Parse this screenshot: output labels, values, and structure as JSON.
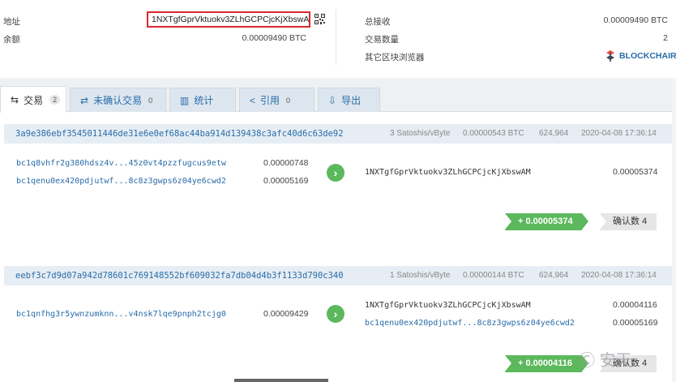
{
  "summary": {
    "address_label": "地址",
    "address": "1NXTgfGprVktuokv3ZLhGCPCjcKjXbswAM",
    "balance_label": "余额",
    "balance": "0.00009490 BTC",
    "total_received_label": "总接收",
    "total_received": "0.00009490 BTC",
    "tx_count_label": "交易数量",
    "tx_count": "2",
    "other_explorers_label": "其它区块浏览器",
    "explorer_name": "BLOCKCHAIR"
  },
  "tabs": [
    {
      "icon": "⇆",
      "label": "交易",
      "count": "2"
    },
    {
      "icon": "⇄",
      "label": "未确认交易",
      "count": "0"
    },
    {
      "icon": "▥",
      "label": "统计",
      "count": ""
    },
    {
      "icon": "<",
      "label": "引用",
      "count": "0"
    },
    {
      "icon": "⇩",
      "label": "导出",
      "count": ""
    }
  ],
  "transactions": [
    {
      "hash": "3a9e386ebf3545011446de31e6e0ef68ac44ba914d139438c3afc40d6c63de92",
      "fee_rate": "3 Satoshis/vByte",
      "fee": "0.00000543 BTC",
      "block": "624,964",
      "time": "2020-04-08 17:36:14",
      "inputs": [
        {
          "address": "bc1q8vhfr2g380hdsz4v...45z0vt4pzzfugcus9etw",
          "amount": "0.00000748"
        },
        {
          "address": "bc1qenu0ex420pdjutwf...8c8z3gwps6z04ye6cwd2",
          "amount": "0.00005169"
        }
      ],
      "outputs": [
        {
          "address": "1NXTgfGprVktuokv3ZLhGCPCjcKjXbswAM",
          "amount": "0.00005374"
        }
      ],
      "net_amount": "+ 0.00005374",
      "confirmations": "确认数 4"
    },
    {
      "hash": "eebf3c7d9d07a942d78601c769148552bf609032fa7db04d4b3f1133d790c340",
      "fee_rate": "1 Satoshis/vByte",
      "fee": "0.00000144 BTC",
      "block": "624,964",
      "time": "2020-04-08 17:36:14",
      "inputs": [
        {
          "address": "bc1qnfhg3r5ywnzumknn...v4nsk7lqe9pnph2tcjg0",
          "amount": "0.00009429"
        }
      ],
      "outputs": [
        {
          "address": "1NXTgfGprVktuokv3ZLhGCPCjcKjXbswAM",
          "amount": "0.00004116"
        },
        {
          "address": "bc1qenu0ex420pdjutwf...8c8z3gwps6z04ye6cwd2",
          "amount": "0.00005169"
        }
      ],
      "net_amount": "+ 0.00004116",
      "confirmations": "确认数 4"
    }
  ],
  "watermark": "安天"
}
